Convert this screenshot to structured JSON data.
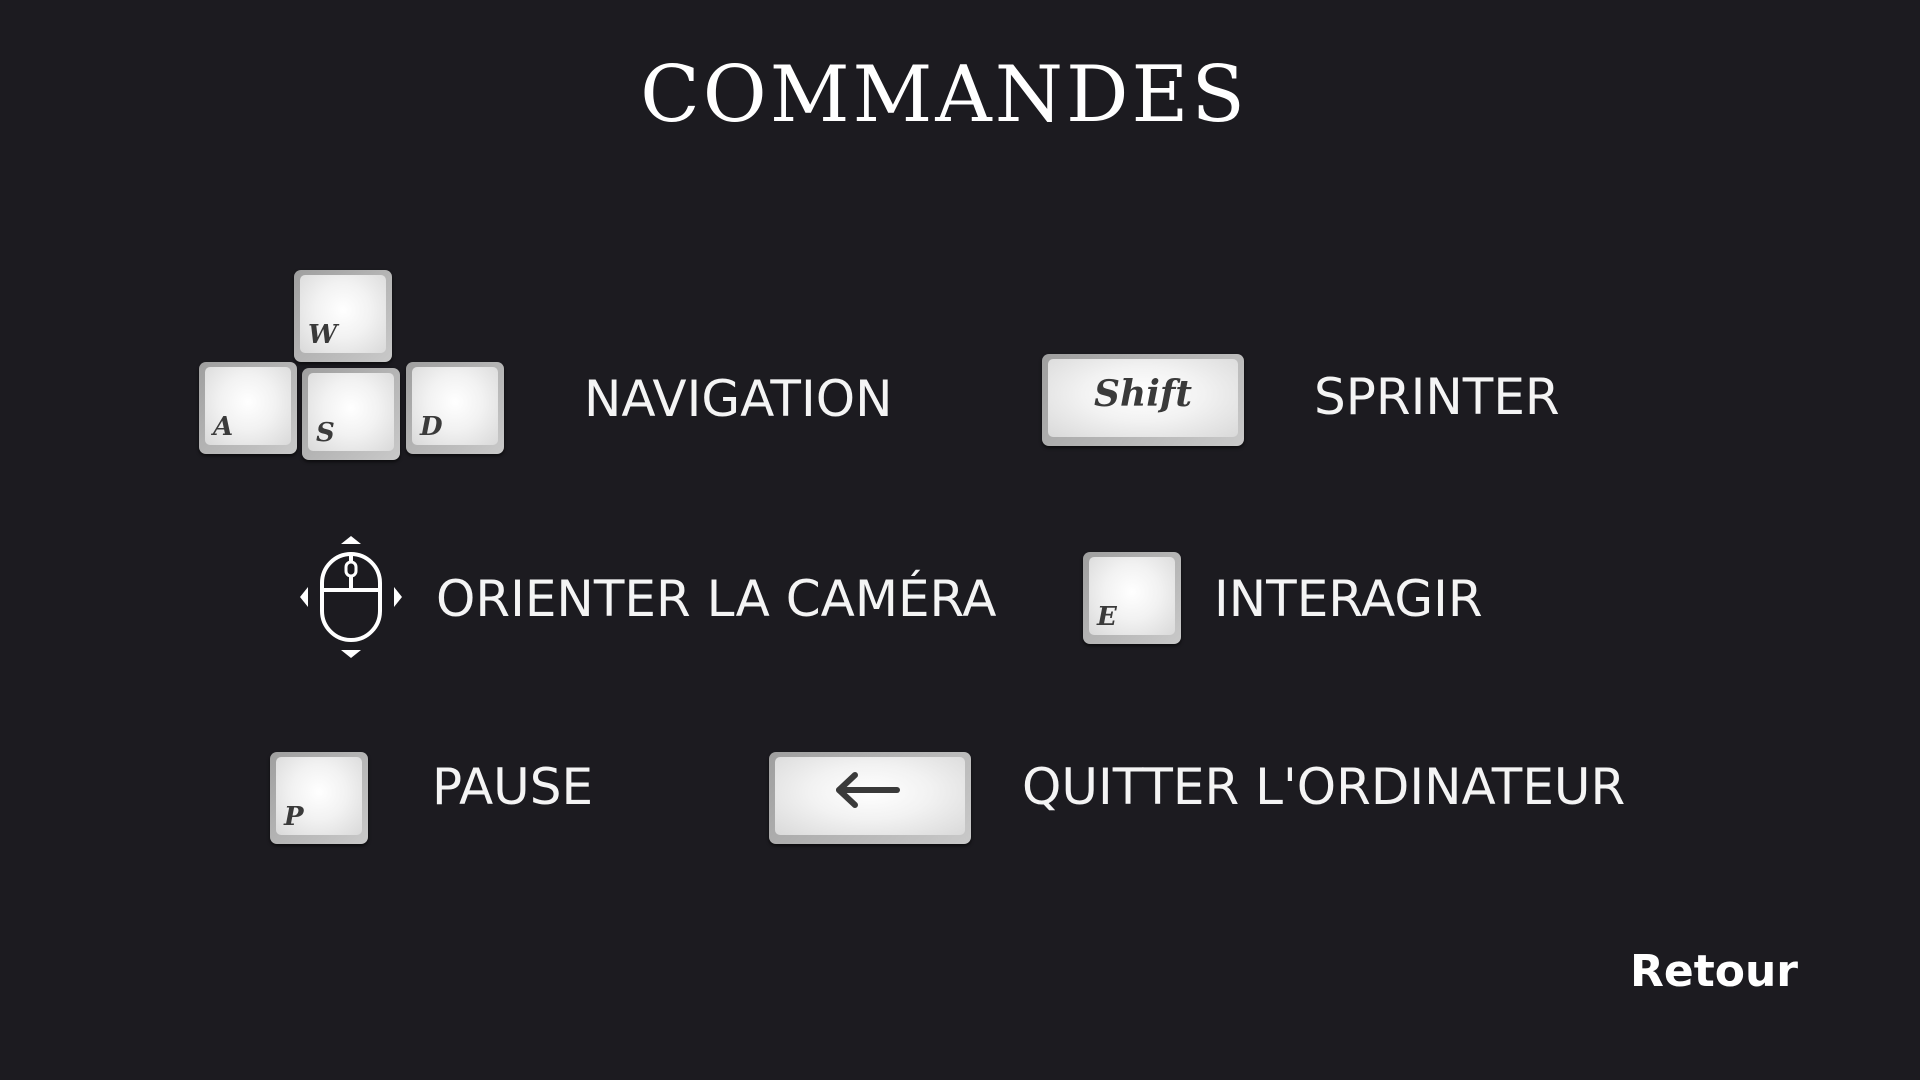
{
  "title": "COMMANDES",
  "controls": {
    "navigation": {
      "label": "NAVIGATION",
      "keys": {
        "w": "W",
        "a": "A",
        "s": "S",
        "d": "D"
      }
    },
    "sprint": {
      "label": "SPRINTER",
      "key": "Shift"
    },
    "camera": {
      "label": "ORIENTER LA CAMÉRA",
      "icon": "mouse-move-icon"
    },
    "interact": {
      "label": "INTERAGIR",
      "key": "E"
    },
    "pause": {
      "label": "PAUSE",
      "key": "P"
    },
    "quit": {
      "label": "QUITTER L'ORDINATEUR",
      "key_icon": "backspace-arrow-icon"
    }
  },
  "back_label": "Retour",
  "colors": {
    "background": "#1c1b20",
    "text": "#ffffff",
    "key_face": "#f2f2f2",
    "key_edge": "#b5b5b5",
    "key_glyph": "#3a3a3a"
  }
}
